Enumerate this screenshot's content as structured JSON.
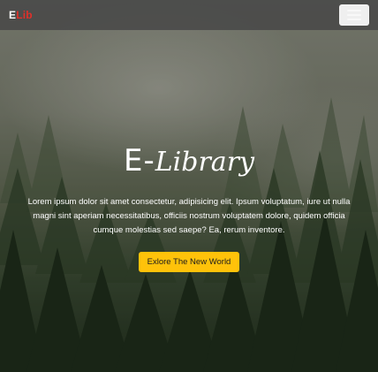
{
  "navbar": {
    "brand_e": "E",
    "brand_lib": "Lib",
    "menu_icon": "hamburger-menu-icon"
  },
  "hero": {
    "title_e": "E-",
    "title_lib": "Library",
    "description": "Lorem ipsum dolor sit amet consectetur, adipisicing elit. Ipsum voluptatum, iure ut nulla magni sint aperiam necessitatibus, officiis nostrum voluptatem dolore, quidem officia cumque molestias sed saepe? Ea, rerum inventore.",
    "cta_label": "Exlore The New World"
  },
  "colors": {
    "navbar_bg": "#464646",
    "brand_accent": "#e0302a",
    "cta_bg": "#ffc20a",
    "text": "#ffffff"
  }
}
